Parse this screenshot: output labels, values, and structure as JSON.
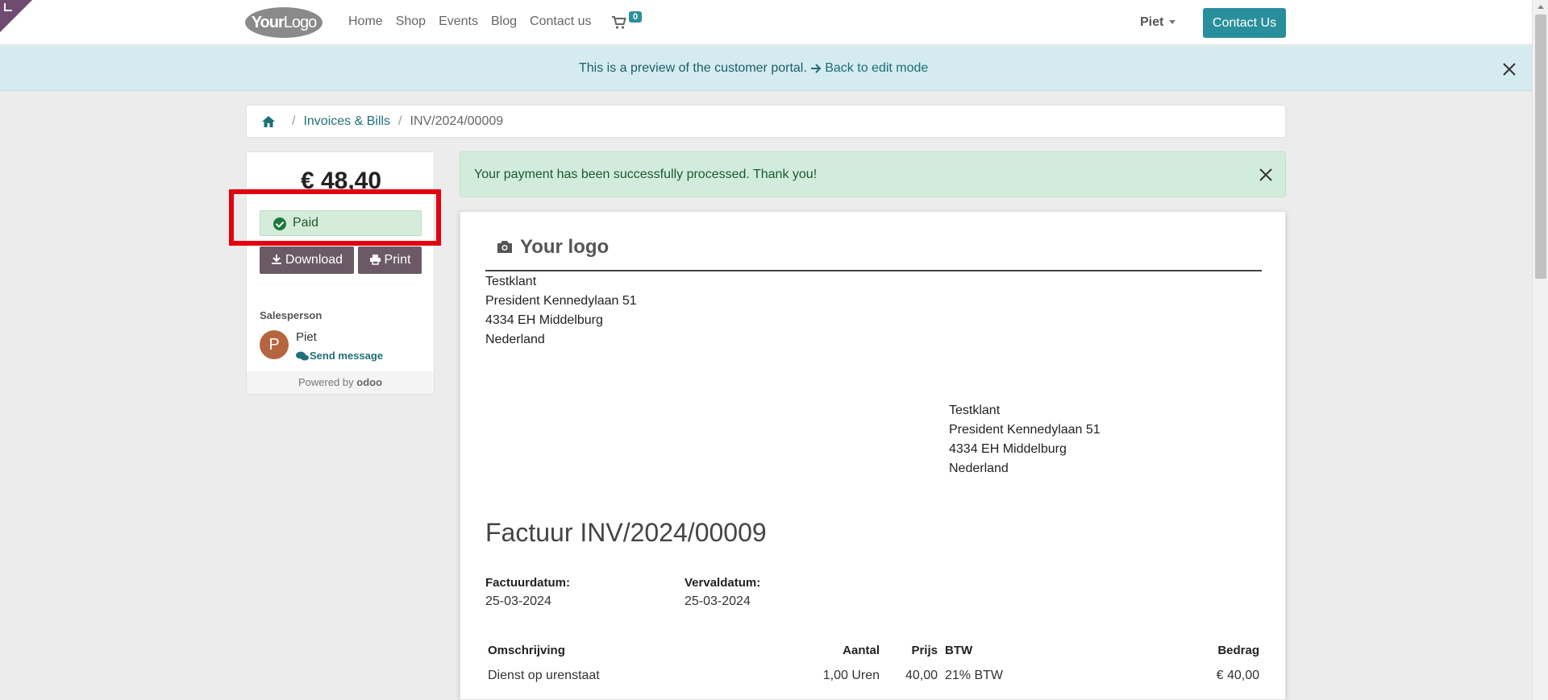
{
  "nav": {
    "logo_bold": "Your",
    "logo_light": "Logo",
    "links": [
      "Home",
      "Shop",
      "Events",
      "Blog",
      "Contact us"
    ],
    "cart_count": "0",
    "user": "Piet",
    "contact_button": "Contact Us"
  },
  "preview": {
    "text": "This is a preview of the customer portal.",
    "back_link": "Back to edit mode"
  },
  "breadcrumb": {
    "section": "Invoices & Bills",
    "current": "INV/2024/00009"
  },
  "sidebar": {
    "amount": "€ 48,40",
    "status": "Paid",
    "download": "Download",
    "print": "Print",
    "salesperson_label": "Salesperson",
    "avatar_initial": "P",
    "salesperson_name": "Piet",
    "send_message": "Send message",
    "powered_prefix": "Powered by",
    "powered_brand": "odoo"
  },
  "alert": {
    "text": "Your payment has been successfully processed. Thank you!"
  },
  "invoice": {
    "logo_text": "Your logo",
    "address_from": {
      "line1": "Testklant",
      "line2": "President Kennedylaan 51",
      "line3": "4334 EH Middelburg",
      "line4": "Nederland"
    },
    "address_to": {
      "line1": "Testklant",
      "line2": "President Kennedylaan 51",
      "line3": "4334 EH Middelburg",
      "line4": "Nederland"
    },
    "title": "Factuur INV/2024/00009",
    "invoice_date_label": "Factuurdatum:",
    "invoice_date": "25-03-2024",
    "due_date_label": "Vervaldatum:",
    "due_date": "25-03-2024",
    "columns": {
      "description": "Omschrijving",
      "quantity": "Aantal",
      "price": "Prijs",
      "tax": "BTW",
      "amount": "Bedrag"
    },
    "lines": [
      {
        "description": "Dienst op urenstaat",
        "quantity": "1,00 Uren",
        "price": "40,00",
        "tax": "21% BTW",
        "amount": "€ 40,00"
      }
    ]
  },
  "colors": {
    "brand_teal": "#2a8f9c",
    "paid_green": "#1b7a3a",
    "button_mauve": "#6b5a65",
    "highlight_red": "#e3000f"
  }
}
